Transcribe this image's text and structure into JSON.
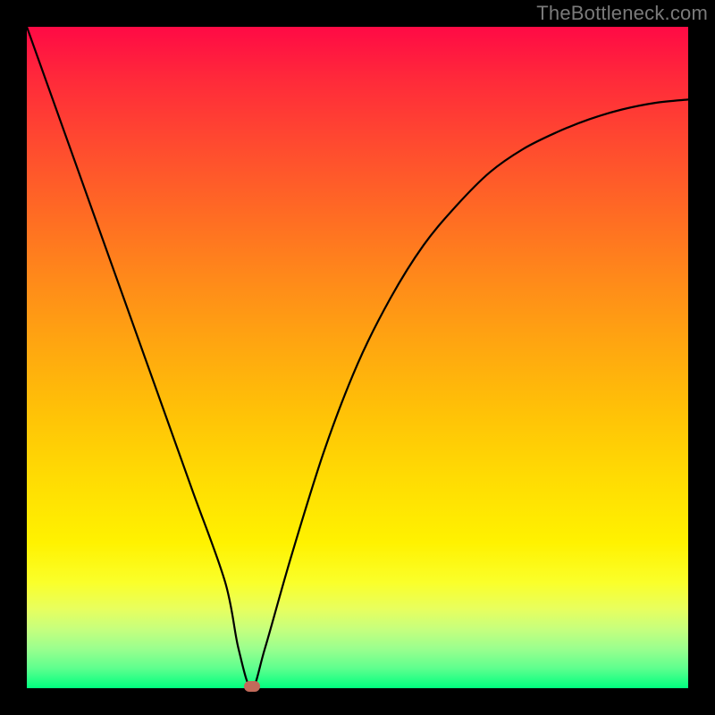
{
  "watermark": "TheBottleneck.com",
  "colors": {
    "frame": "#000000",
    "curve": "#000000",
    "dot": "#c26a5a",
    "gradient_top": "#ff0a45",
    "gradient_bottom": "#00ff7f"
  },
  "chart_data": {
    "type": "line",
    "title": "",
    "xlabel": "",
    "ylabel": "",
    "xlim": [
      0,
      100
    ],
    "ylim": [
      0,
      100
    ],
    "series": [
      {
        "name": "bottleneck-curve",
        "x": [
          0,
          5,
          10,
          15,
          20,
          25,
          30,
          32,
          34,
          36,
          40,
          45,
          50,
          55,
          60,
          65,
          70,
          75,
          80,
          85,
          90,
          95,
          100
        ],
        "y": [
          100,
          86,
          72,
          58,
          44,
          30,
          16,
          6,
          0,
          6,
          20,
          36,
          49,
          59,
          67,
          73,
          78,
          81.5,
          84,
          86,
          87.5,
          88.5,
          89
        ]
      }
    ],
    "minimum_marker": {
      "x": 34,
      "y": 0
    }
  }
}
